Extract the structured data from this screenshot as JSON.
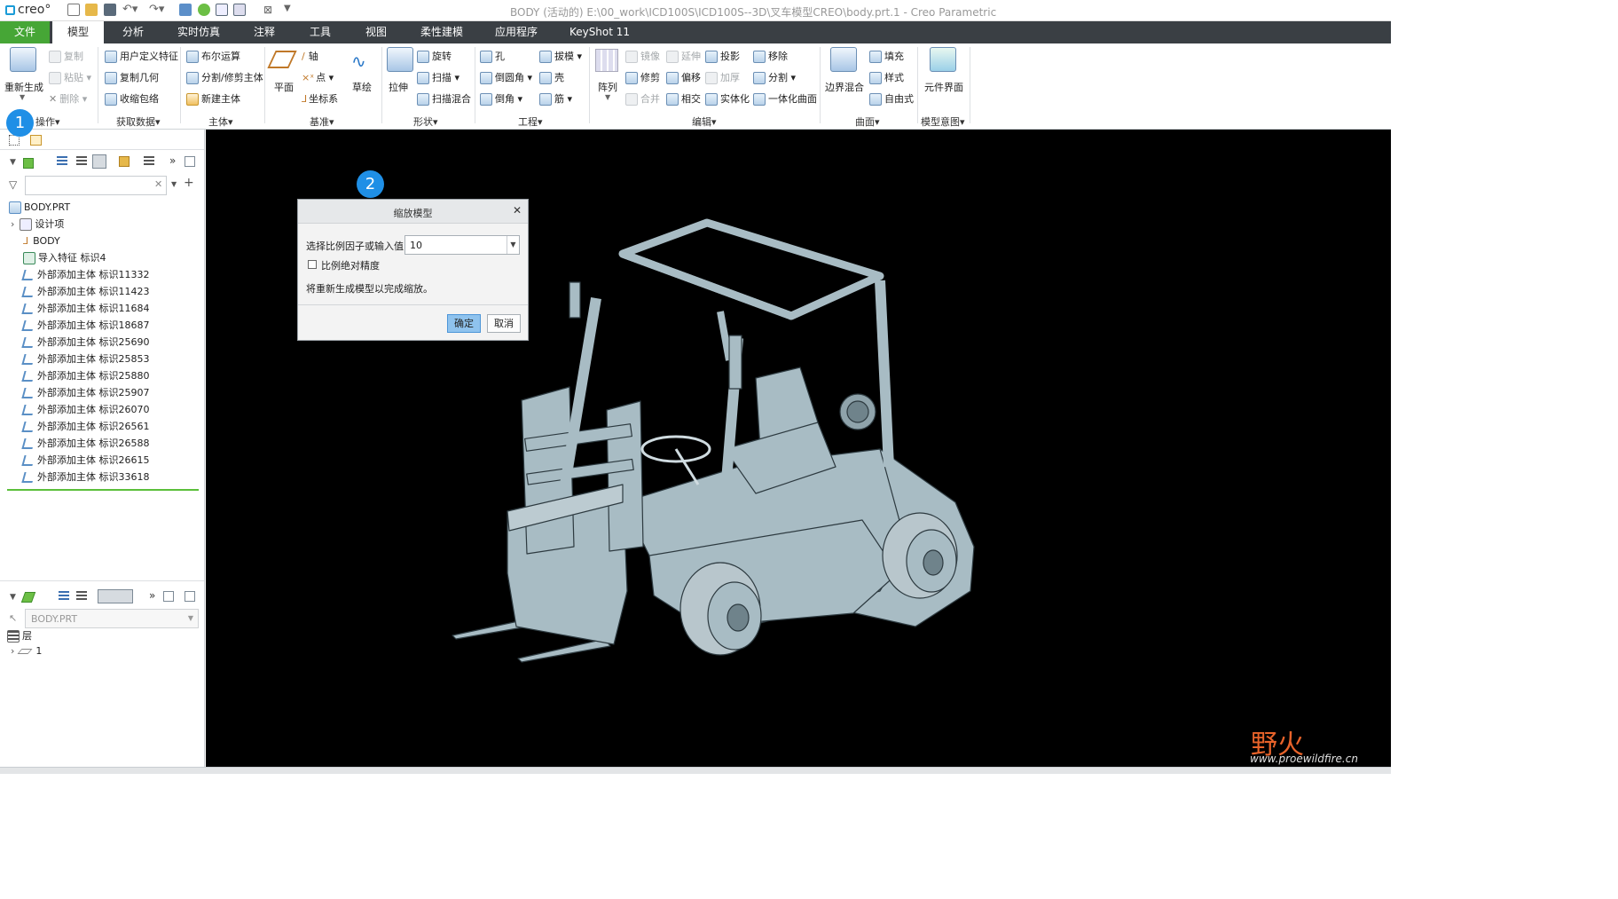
{
  "app": {
    "logo_text": "creo°",
    "window_title": "BODY (活动的) E:\\00_work\\ICD100S\\ICD100S--3D\\叉车模型CREO\\body.prt.1 - Creo Parametric"
  },
  "tabs": [
    "文件",
    "模型",
    "分析",
    "实时仿真",
    "注释",
    "工具",
    "视图",
    "柔性建模",
    "应用程序",
    "KeyShot 11"
  ],
  "ribbon": {
    "operations": {
      "regen": "重新生成",
      "copy": "复制",
      "paste": "粘贴",
      "delete": "删除",
      "group": "操作"
    },
    "get_data": {
      "udf": "用户定义特征",
      "copy_geom": "复制几何",
      "shrinkwrap": "收缩包络",
      "group": "获取数据"
    },
    "body": {
      "boolean": "布尔运算",
      "split_trim": "分割/修剪主体",
      "new_body": "新建主体",
      "group": "主体"
    },
    "datum": {
      "plane": "平面",
      "axis": "轴",
      "point": "点",
      "csys": "坐标系",
      "sketch": "草绘",
      "group": "基准"
    },
    "shapes": {
      "extrude": "拉伸",
      "revolve": "旋转",
      "sweep": "扫描",
      "swept_blend": "扫描混合",
      "group": "形状"
    },
    "engineering": {
      "hole": "孔",
      "round": "倒圆角",
      "chamfer": "倒角",
      "draft": "拔模",
      "shell": "壳",
      "rib": "筋",
      "group": "工程"
    },
    "editing": {
      "pattern": "阵列",
      "mirror": "镜像",
      "trim": "修剪",
      "merge": "合并",
      "extend": "延伸",
      "offset": "偏移",
      "intersect": "相交",
      "project": "投影",
      "thicken": "加厚",
      "solidify": "实体化",
      "remove": "移除",
      "split": "分割",
      "unify": "一体化曲面",
      "group": "编辑"
    },
    "surfaces": {
      "boundary_blend": "边界混合",
      "fill": "填充",
      "style": "样式",
      "freestyle": "自由式",
      "group": "曲面"
    },
    "model_intent": {
      "component_interface": "元件界面",
      "group": "模型意图"
    }
  },
  "model_tree": {
    "search_placeholder": "",
    "root": "BODY.PRT",
    "items": [
      "设计项",
      "BODY",
      "导入特征 标识4",
      "外部添加主体 标识11332",
      "外部添加主体 标识11423",
      "外部添加主体 标识11684",
      "外部添加主体 标识18687",
      "外部添加主体 标识25690",
      "外部添加主体 标识25853",
      "外部添加主体 标识25880",
      "外部添加主体 标识25907",
      "外部添加主体 标识26070",
      "外部添加主体 标识26561",
      "外部添加主体 标识26588",
      "外部添加主体 标识26615",
      "外部添加主体 标识33618"
    ]
  },
  "layer_tree": {
    "model_select": "BODY.PRT",
    "header": "层",
    "item": "1"
  },
  "dialog": {
    "title": "缩放模型",
    "prompt": "选择比例因子或输入值:",
    "value": "10",
    "checkbox_label": "比例绝对精度",
    "checkbox_checked": false,
    "note": "将重新生成模型以完成缩放。",
    "ok": "确定",
    "cancel": "取消"
  },
  "badges": [
    "1",
    "2"
  ],
  "watermark": {
    "logo_text": "野火",
    "url": "www.proewildfire.cn"
  },
  "colors": {
    "accent_blue": "#1f8fe6",
    "file_tab": "#46a636",
    "tab_bar": "#3a3f44",
    "model": "#a8bcc4"
  }
}
